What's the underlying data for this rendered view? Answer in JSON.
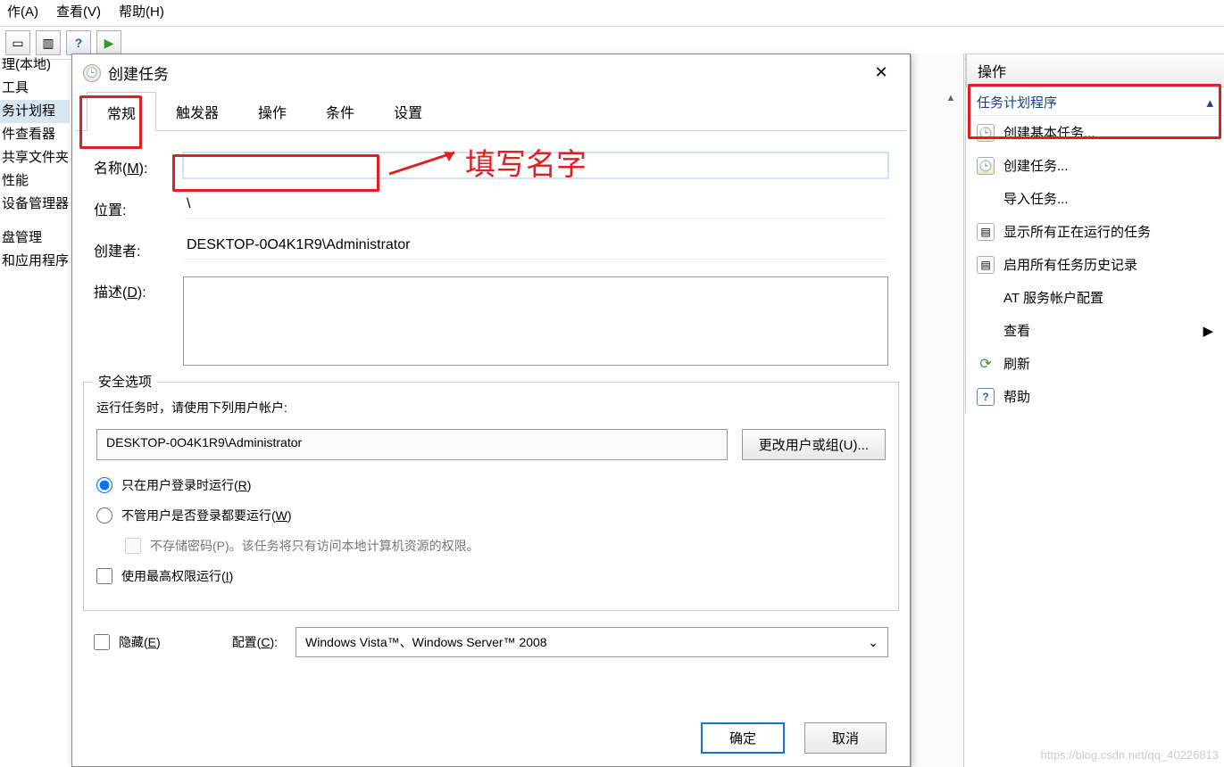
{
  "menu": {
    "action": "作(A)",
    "view": "查看(V)",
    "help": "帮助(H)"
  },
  "tree": {
    "root": "理(本地)",
    "tools": "工具",
    "scheduler": "务计划程",
    "eventviewer": "件查看器",
    "sharedfolders": "共享文件夹",
    "performance": "性能",
    "devicemgr": "设备管理器",
    "diskmgmt": "盘管理",
    "services": "和应用程序"
  },
  "dialog": {
    "title": "创建任务",
    "tabs": {
      "general": "常规",
      "triggers": "触发器",
      "actions": "操作",
      "conditions": "条件",
      "settings": "设置"
    },
    "name_label": "名称(M):",
    "name_value": "",
    "location_label": "位置:",
    "location_value": "\\",
    "author_label": "创建者:",
    "author_value": "DESKTOP-0O4K1R9\\Administrator",
    "desc_label": "描述(D):",
    "desc_value": "",
    "security_legend": "安全选项",
    "security_info": "运行任务时，请使用下列用户帐户:",
    "user_account": "DESKTOP-0O4K1R9\\Administrator",
    "change_user_btn": "更改用户或组(U)...",
    "radio_logged_on": "只在用户登录时运行(R)",
    "radio_any": "不管用户是否登录都要运行(W)",
    "no_store_pwd": "不存储密码(P)。该任务将只有访问本地计算机资源的权限。",
    "highest_priv": "使用最高权限运行(I)",
    "hidden": "隐藏(E)",
    "config_label": "配置(C):",
    "config_value": "Windows Vista™、Windows Server™ 2008",
    "ok": "确定",
    "cancel": "取消"
  },
  "actions_pane": {
    "title": "操作",
    "section": "任务计划程序",
    "create_basic": "创建基本任务...",
    "create_task": "创建任务...",
    "import_task": "导入任务...",
    "show_running": "显示所有正在运行的任务",
    "enable_history": "启用所有任务历史记录",
    "at_service": "AT 服务帐户配置",
    "view": "查看",
    "refresh": "刷新",
    "help": "帮助"
  },
  "annotation": {
    "fill_name": "填写名字"
  },
  "watermark": "https://blog.csdn.net/qq_40226813"
}
